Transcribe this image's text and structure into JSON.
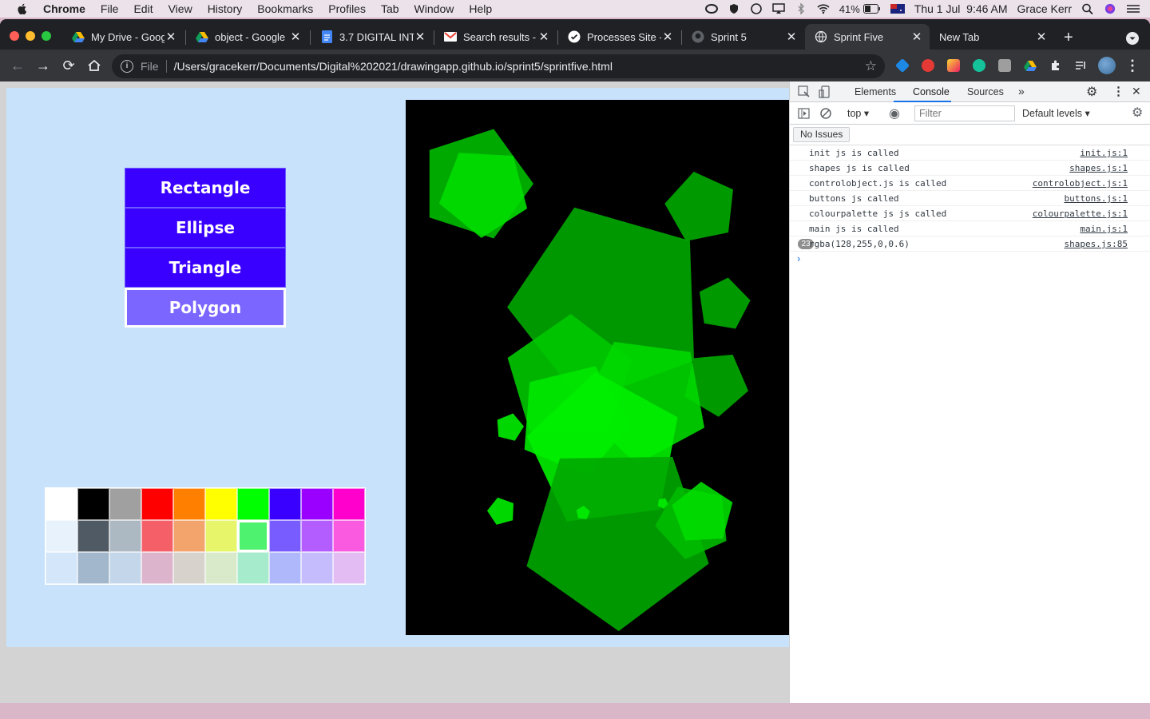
{
  "menubar": {
    "app": "Chrome",
    "items": [
      "File",
      "Edit",
      "View",
      "History",
      "Bookmarks",
      "Profiles",
      "Tab",
      "Window",
      "Help"
    ],
    "battery": "41%",
    "datetime": "Thu 1 Jul  9:46 AM",
    "user": "Grace Kerr"
  },
  "tabs": [
    {
      "title": "My Drive - Goog",
      "icon": "google-drive-icon"
    },
    {
      "title": "object - Google",
      "icon": "google-drive-icon"
    },
    {
      "title": "3.7 DIGITAL INT",
      "icon": "google-docs-icon"
    },
    {
      "title": "Search results -",
      "icon": "gmail-icon"
    },
    {
      "title": "Processes Site -",
      "icon": "google-sites-icon"
    },
    {
      "title": "Sprint 5",
      "icon": "github-icon"
    },
    {
      "title": "Sprint Five",
      "icon": "globe-icon",
      "active": true
    },
    {
      "title": "New Tab",
      "icon": ""
    }
  ],
  "toolbar": {
    "scheme": "File",
    "url": "/Users/gracekerr/Documents/Digital%202021/drawingapp.github.io/sprint5/sprintfive.html"
  },
  "app": {
    "shape_buttons": [
      {
        "label": "Rectangle",
        "selected": false
      },
      {
        "label": "Ellipse",
        "selected": false
      },
      {
        "label": "Triangle",
        "selected": false
      },
      {
        "label": "Polygon",
        "selected": true
      }
    ],
    "palette": [
      [
        "#ffffff",
        "#000000",
        "#a0a0a0",
        "#ff0000",
        "#ff7f00",
        "#ffff00",
        "#00ff00",
        "#3a00ff",
        "#9900ff",
        "#ff00cc"
      ],
      [
        "#e8f2fc",
        "#505a64",
        "#acb8c2",
        "#f56068",
        "#f2a46c",
        "#e6f56a",
        "#4ff26e",
        "#785cff",
        "#b35cff",
        "#f95ae0"
      ],
      [
        "#d4e6fa",
        "#a2b6cc",
        "#c4d6ea",
        "#dcb4cc",
        "#d8d2cc",
        "#d8eaca",
        "#a6eccc",
        "#b0b8fc",
        "#c4bcfc",
        "#e2bcf2"
      ]
    ],
    "selected_swatch": "#4ff26e"
  },
  "devtools": {
    "tabs": [
      "Elements",
      "Console",
      "Sources"
    ],
    "active_tab": "Console",
    "context": "top",
    "filter_placeholder": "Filter",
    "levels": "Default levels",
    "issues": "No Issues",
    "logs": [
      {
        "msg": "init js is called",
        "src": "init.js:1"
      },
      {
        "msg": "shapes js is called",
        "src": "shapes.js:1"
      },
      {
        "msg": "controlobject.js is called",
        "src": "controlobject.js:1"
      },
      {
        "msg": "buttons js called",
        "src": "buttons.js:1"
      },
      {
        "msg": "colourpalette js js called",
        "src": "colourpalette.js:1"
      },
      {
        "msg": "main js is called",
        "src": "main.js:1"
      },
      {
        "msg": "rgba(128,255,0,0.6)",
        "src": "shapes.js:85",
        "count": "23"
      }
    ]
  }
}
